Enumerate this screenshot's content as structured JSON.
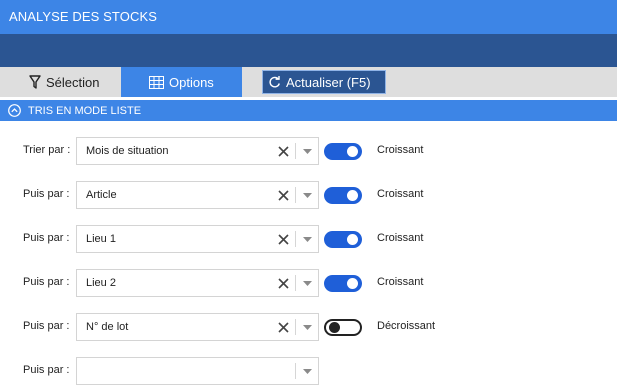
{
  "window": {
    "title": "ANALYSE DES STOCKS"
  },
  "tabs": {
    "selection_label": "Sélection",
    "options_label": "Options",
    "refresh_label": "Actualiser (F5)"
  },
  "section": {
    "title": "TRIS EN MODE LISTE"
  },
  "sort_rows": [
    {
      "label": "Trier par :",
      "value": "Mois de situation",
      "ascending": true,
      "direction": "Croissant"
    },
    {
      "label": "Puis par :",
      "value": "Article",
      "ascending": true,
      "direction": "Croissant"
    },
    {
      "label": "Puis par :",
      "value": "Lieu 1",
      "ascending": true,
      "direction": "Croissant"
    },
    {
      "label": "Puis par :",
      "value": "Lieu 2",
      "ascending": true,
      "direction": "Croissant"
    },
    {
      "label": "Puis par :",
      "value": "N° de lot",
      "ascending": false,
      "direction": "Décroissant"
    },
    {
      "label": "Puis par :",
      "value": ""
    }
  ],
  "colors": {
    "title_bar": "#3d85e6",
    "dark_band": "#2b5592",
    "toggle_on": "#1f5fd8"
  },
  "icons": {
    "selection": "filter-icon",
    "options": "grid-icon",
    "refresh": "refresh-icon",
    "section": "chevron-up-circle-icon"
  }
}
